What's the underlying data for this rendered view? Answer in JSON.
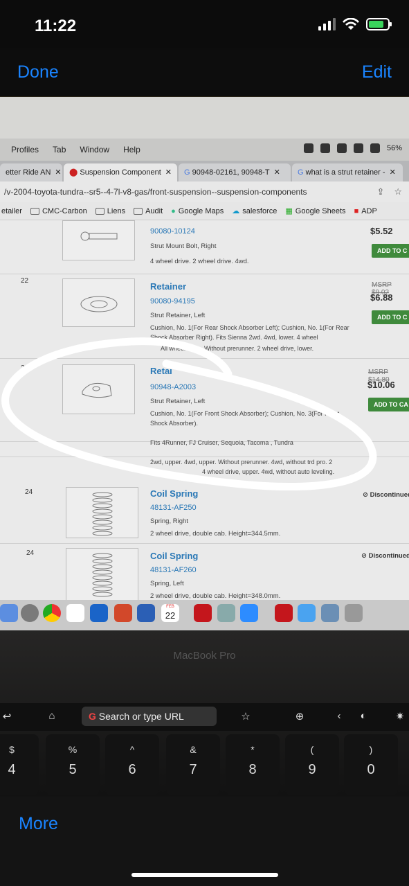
{
  "status": {
    "time": "11:22"
  },
  "nav": {
    "done": "Done",
    "edit": "Edit",
    "more": "More"
  },
  "mac": {
    "menu": [
      "Profiles",
      "Tab",
      "Window",
      "Help"
    ],
    "battery_pct": "56%",
    "tabs": [
      {
        "title": "etter Ride AN"
      },
      {
        "title": "Suspension Component"
      },
      {
        "title": "90948-02161, 90948-T"
      },
      {
        "title": "what is a strut retainer -"
      }
    ],
    "url": "/v-2004-toyota-tundra--sr5--4-7l-v8-gas/front-suspension--suspension-components",
    "bookmarks": [
      "etailer",
      "CMC-Carbon",
      "Liens",
      "Audit",
      "Google Maps",
      "salesforce",
      "Google Sheets",
      "ADP"
    ],
    "dock_day": "22",
    "dock_month": "FEB",
    "machine_label": "MacBook Pro"
  },
  "parts": {
    "row0": {
      "part_number": "90080-10124",
      "desc": "Strut Mount Bolt, Right",
      "note": "4 wheel drive. 2 wheel drive. 4wd.",
      "price": "$5.52",
      "add": "ADD TO C"
    },
    "row1": {
      "num": "22",
      "name": "Retainer",
      "part_number": "90080-94195",
      "desc": "Strut Retainer, Left",
      "note": "Cushion, No. 1(For Rear Shock Absorber Left); Cushion, No. 1(For Rear Shock Absorber Right). Fits Sienna 2wd. 4wd, lower. 4 wheel",
      "note2": "All wheel drive. Without prerunner. 2 wheel drive, lower.",
      "msrp": "MSRP $9.02",
      "price": "$6.88",
      "add": "ADD TO C"
    },
    "row2": {
      "num": "23",
      "name": "Retai",
      "part_number": "90948-A2003",
      "desc": "Strut Retainer, Left",
      "note": "Cushion, No. 1(For Front Shock Absorber); Cushion, No. 3(For Front Shock Absorber).",
      "fits": "Fits 4Runner, FJ Cruiser, Sequoia, Tacoma , Tundra",
      "note2": "2wd, upper. 4wd, upper. Without prerunner. 4wd, without trd pro. 2",
      "note3": "4 wheel drive, upper. 4wd, without auto leveling.",
      "msrp": "MSRP $14.80",
      "price": "$10.06",
      "add": "ADD TO CA"
    },
    "row3": {
      "num": "24",
      "name": "Coil Spring",
      "part_number": "48131-AF250",
      "desc": "Spring, Right",
      "note": "2 wheel drive, double cab. Height=344.5mm.",
      "status": "Discontinued"
    },
    "row4": {
      "num": "24",
      "name": "Coil Spring",
      "part_number": "48131-AF260",
      "desc": "Spring, Left",
      "note": "2 wheel drive, double cab. Height=348.0mm.",
      "status": "Discontinued"
    }
  },
  "touchbar": {
    "search": "Search or type URL"
  },
  "keys": [
    {
      "up": "$",
      "down": "4"
    },
    {
      "up": "%",
      "down": "5"
    },
    {
      "up": "^",
      "down": "6"
    },
    {
      "up": "&",
      "down": "7"
    },
    {
      "up": "*",
      "down": "8"
    },
    {
      "up": "(",
      "down": "9"
    },
    {
      "up": ")",
      "down": "0"
    }
  ],
  "colors": {
    "ios_blue": "#1a84ff",
    "link_blue": "#2a78b6",
    "add_green": "#3f8a3c",
    "annotation": "#ffffff"
  }
}
